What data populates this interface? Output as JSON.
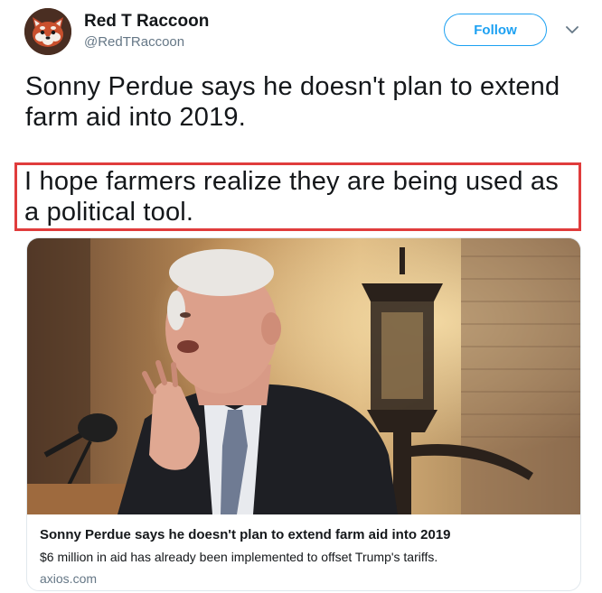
{
  "author": {
    "name": "Red T Raccoon",
    "handle": "@RedTRaccoon",
    "avatar_icon": "red-panda-avatar-icon"
  },
  "actions": {
    "follow_label": "Follow",
    "menu_icon": "chevron-down-icon"
  },
  "tweet": {
    "text": "Sonny Perdue says he doesn't plan to extend farm aid into 2019.",
    "highlighted_text": "I hope farmers realize they are being used as a political tool."
  },
  "card": {
    "title": "Sonny Perdue says he doesn't plan to extend farm aid into 2019",
    "description": "$6 million in aid has already been implemented to offset Trump's tariffs.",
    "domain": "axios.com"
  },
  "colors": {
    "accent": "#1da1f2",
    "highlight_border": "#e03c3c",
    "secondary_text": "#657786"
  }
}
